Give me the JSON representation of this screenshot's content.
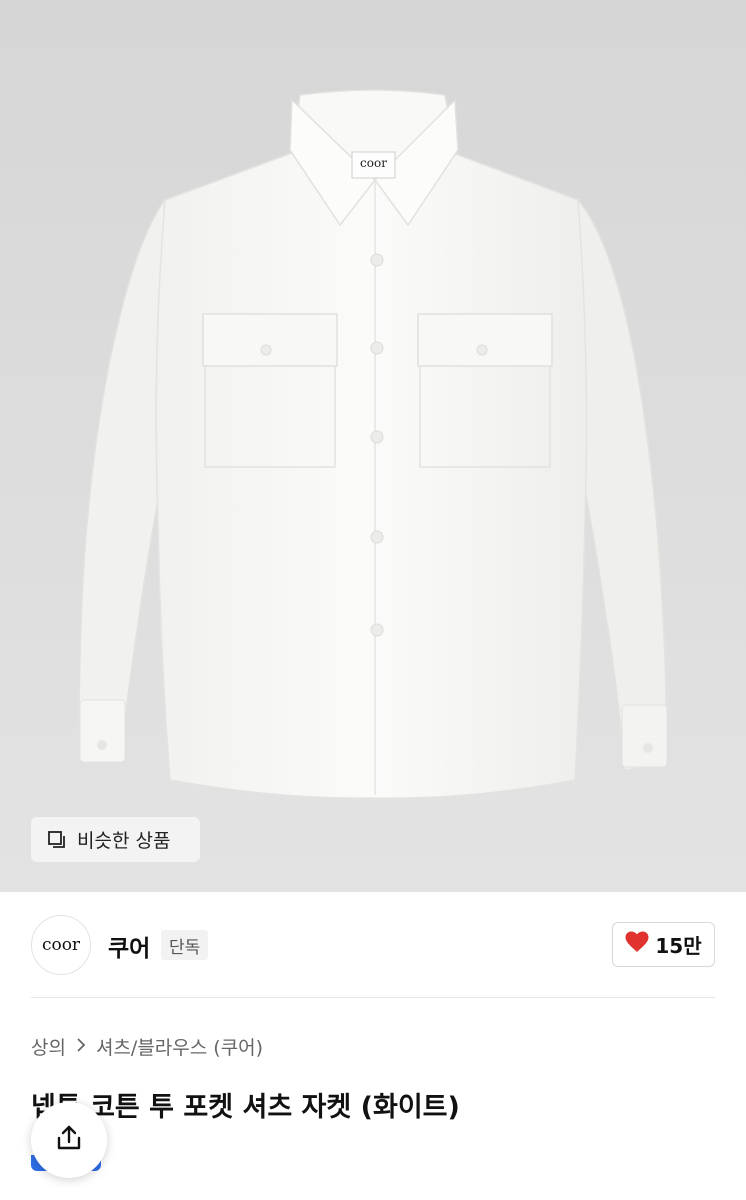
{
  "product_image": {
    "label_text": "coor",
    "similar_button_label": "비슷한 상품",
    "similar_icon": "similar-items-icon"
  },
  "brand": {
    "logo_text": "coor",
    "name": "쿠어",
    "tag": "단독"
  },
  "like": {
    "icon": "heart-icon",
    "count": "15만",
    "color": "#e0322f"
  },
  "breadcrumb": {
    "category": "상의",
    "subcategory": "셔츠/블라우스 (쿠어)"
  },
  "product": {
    "title": "넵튼 코튼 투 포켓 셔츠 자켓 (화이트)"
  },
  "share": {
    "icon": "share-icon"
  },
  "colors": {
    "image_bg": "#dcdcdc",
    "accent_blue": "#2f6fe8"
  }
}
